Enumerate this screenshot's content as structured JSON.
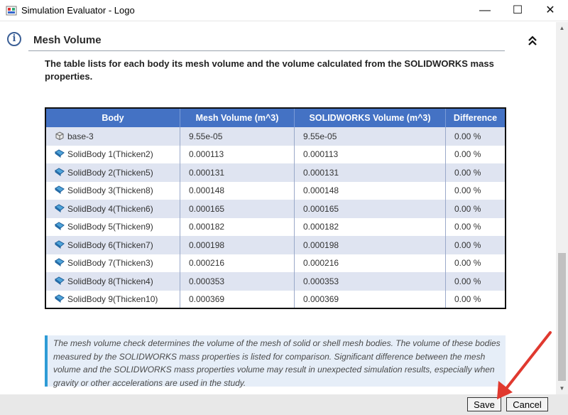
{
  "window": {
    "title": "Simulation Evaluator - Logo",
    "minimize": "—",
    "maximize": "☐",
    "close": "✕"
  },
  "section": {
    "title": "Mesh Volume",
    "description": "The table lists for each body its mesh volume and the volume calculated from the SOLIDWORKS mass properties."
  },
  "table": {
    "headers": [
      "Body",
      "Mesh Volume (m^3)",
      "SOLIDWORKS Volume (m^3)",
      "Difference"
    ],
    "rows": [
      {
        "icon": "part-icon",
        "body": "base-3",
        "mesh": "9.55e-05",
        "sw": "9.55e-05",
        "diff": "0.00 %"
      },
      {
        "icon": "sheet-body-icon",
        "body": "SolidBody 1(Thicken2)",
        "mesh": "0.000113",
        "sw": "0.000113",
        "diff": "0.00 %"
      },
      {
        "icon": "sheet-body-icon",
        "body": "SolidBody 2(Thicken5)",
        "mesh": "0.000131",
        "sw": "0.000131",
        "diff": "0.00 %"
      },
      {
        "icon": "sheet-body-icon",
        "body": "SolidBody 3(Thicken8)",
        "mesh": "0.000148",
        "sw": "0.000148",
        "diff": "0.00 %"
      },
      {
        "icon": "sheet-body-icon",
        "body": "SolidBody 4(Thicken6)",
        "mesh": "0.000165",
        "sw": "0.000165",
        "diff": "0.00 %"
      },
      {
        "icon": "sheet-body-icon",
        "body": "SolidBody 5(Thicken9)",
        "mesh": "0.000182",
        "sw": "0.000182",
        "diff": "0.00 %"
      },
      {
        "icon": "sheet-body-icon",
        "body": "SolidBody 6(Thicken7)",
        "mesh": "0.000198",
        "sw": "0.000198",
        "diff": "0.00 %"
      },
      {
        "icon": "sheet-body-icon",
        "body": "SolidBody 7(Thicken3)",
        "mesh": "0.000216",
        "sw": "0.000216",
        "diff": "0.00 %"
      },
      {
        "icon": "sheet-body-icon",
        "body": "SolidBody 8(Thicken4)",
        "mesh": "0.000353",
        "sw": "0.000353",
        "diff": "0.00 %"
      },
      {
        "icon": "sheet-body-icon",
        "body": "SolidBody 9(Thicken10)",
        "mesh": "0.000369",
        "sw": "0.000369",
        "diff": "0.00 %"
      }
    ]
  },
  "note": "The mesh volume check determines the volume of the mesh of solid or shell mesh bodies. The volume of these bodies measured by the SOLIDWORKS mass properties is listed for comparison. Significant difference between the mesh volume and the SOLIDWORKS mass properties volume may result in unexpected simulation results, especially when gravity or other accelerations are used in the study.",
  "buttons": {
    "save": "Save",
    "cancel": "Cancel"
  },
  "colors": {
    "header_bg": "#4472c4",
    "odd_row": "#dfe4f1",
    "note_bg": "#e6eef8",
    "note_bar": "#2e9bd6",
    "arrow": "#e0392f"
  },
  "icons": {
    "app": "app-icon",
    "info": "info-icon",
    "collapse": "collapse-up-icon"
  }
}
